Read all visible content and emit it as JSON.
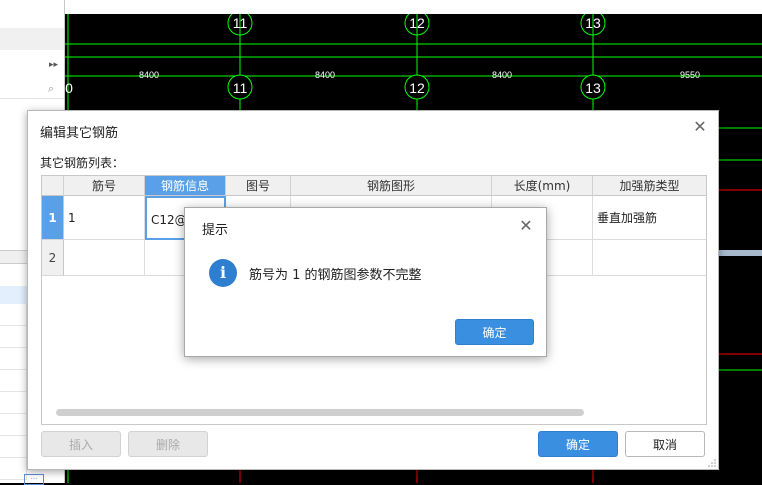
{
  "cad": {
    "axis_labels_top": [
      "11",
      "12",
      "13"
    ],
    "axis_labels_mid": [
      "0",
      "11",
      "12",
      "13"
    ],
    "dimensions": [
      "8400",
      "8400",
      "8400",
      "9550"
    ]
  },
  "dialog": {
    "title": "编辑其它钢筋",
    "list_label": "其它钢筋列表：",
    "columns": [
      "筋号",
      "钢筋信息",
      "图号",
      "钢筋图形",
      "长度(mm)",
      "加强筋类型"
    ],
    "rows": [
      {
        "num": "1",
        "cells": [
          "1",
          "C12@",
          "",
          "",
          "",
          "垂直加强筋"
        ]
      },
      {
        "num": "2",
        "cells": [
          "",
          "",
          "",
          "",
          "",
          ""
        ]
      }
    ],
    "buttons": {
      "insert": "插入",
      "delete": "删除",
      "ok": "确定",
      "cancel": "取消"
    },
    "close_icon": "close-icon"
  },
  "prompt": {
    "title": "提示",
    "message": "筋号为 1 的钢筋图参数不完整",
    "ok": "确定",
    "icon": "info-icon"
  },
  "colors": {
    "accent": "#3b8fe0",
    "header_active": "#5aa0e8",
    "cad_green": "#00ff00",
    "cad_red": "#ff0000"
  }
}
